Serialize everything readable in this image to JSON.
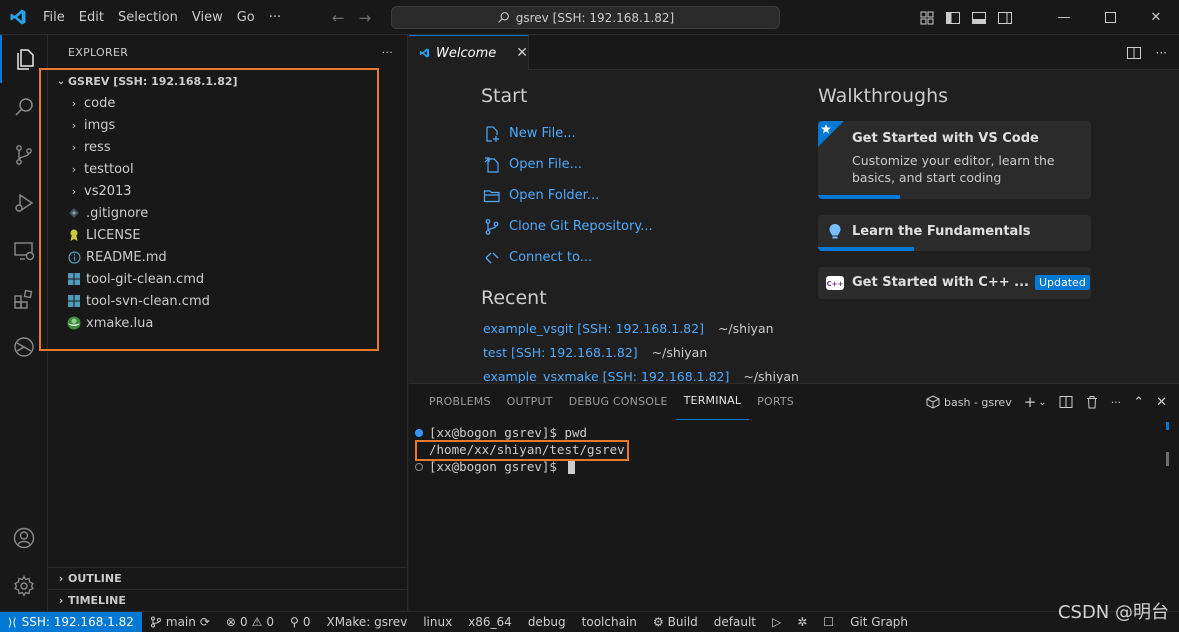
{
  "titlebar": {
    "menu": [
      "File",
      "Edit",
      "Selection",
      "View",
      "Go",
      "···"
    ],
    "command_center": "gsrev [SSH: 192.168.1.82]"
  },
  "sidebar": {
    "title": "EXPLORER",
    "more": "···",
    "root": "GSREV [SSH: 192.168.1.82]",
    "items": [
      {
        "label": "code",
        "type": "folder",
        "icon": "chevron-right-icon"
      },
      {
        "label": "imgs",
        "type": "folder",
        "icon": "chevron-right-icon"
      },
      {
        "label": "ress",
        "type": "folder",
        "icon": "chevron-right-icon"
      },
      {
        "label": "testtool",
        "type": "folder",
        "icon": "chevron-right-icon"
      },
      {
        "label": "vs2013",
        "type": "folder",
        "icon": "chevron-right-icon"
      },
      {
        "label": ".gitignore",
        "type": "file",
        "icon": "gitignore-icon"
      },
      {
        "label": "LICENSE",
        "type": "file",
        "icon": "license-icon"
      },
      {
        "label": "README.md",
        "type": "file",
        "icon": "info-icon"
      },
      {
        "label": "tool-git-clean.cmd",
        "type": "file",
        "icon": "windows-icon"
      },
      {
        "label": "tool-svn-clean.cmd",
        "type": "file",
        "icon": "windows-icon"
      },
      {
        "label": "xmake.lua",
        "type": "file",
        "icon": "lua-icon"
      }
    ],
    "outline": "OUTLINE",
    "timeline": "TIMELINE"
  },
  "editor": {
    "tab_label": "Welcome",
    "tab_close": "✕"
  },
  "welcome": {
    "start_title": "Start",
    "start_items": [
      "New File...",
      "Open File...",
      "Open Folder...",
      "Clone Git Repository...",
      "Connect to..."
    ],
    "recent_title": "Recent",
    "recent": [
      {
        "name": "example_vsgit [SSH: 192.168.1.82]",
        "path": "~/shiyan"
      },
      {
        "name": "test [SSH: 192.168.1.82]",
        "path": "~/shiyan"
      },
      {
        "name": "example_vsxmake [SSH: 192.168.1.82]",
        "path": "~/shiyan"
      }
    ],
    "walkthroughs_title": "Walkthroughs",
    "walkthroughs": [
      {
        "title": "Get Started with VS Code",
        "desc": "Customize your editor, learn the basics, and start coding",
        "progress": 0.3
      },
      {
        "title": "Learn the Fundamentals",
        "progress": 0.35
      },
      {
        "title": "Get Started with C++ ...",
        "badge": "Updated"
      }
    ]
  },
  "panel": {
    "tabs": [
      "PROBLEMS",
      "OUTPUT",
      "DEBUG CONSOLE",
      "TERMINAL",
      "PORTS"
    ],
    "active_tab": "TERMINAL",
    "terminal_name": "bash - gsrev",
    "lines": [
      {
        "prompt": "[xx@bogon gsrev]$ ",
        "cmd": "pwd"
      },
      {
        "output": "/home/xx/shiyan/test/gsrev"
      },
      {
        "prompt": "[xx@bogon gsrev]$ ",
        "cmd": ""
      }
    ]
  },
  "statusbar": {
    "remote": "SSH: 192.168.1.82",
    "branch": "main",
    "errors": "0",
    "warnings": "0",
    "ports": "0",
    "xmake": "XMake: gsrev",
    "platform": "linux",
    "arch": "x86_64",
    "mode": "debug",
    "toolchain": "toolchain",
    "build": "Build",
    "target": "default",
    "git_graph": "Git Graph"
  },
  "watermark": "CSDN @明台",
  "colors": {
    "accent": "#0078d4",
    "link": "#4daafc",
    "highlight": "#e8782e"
  }
}
